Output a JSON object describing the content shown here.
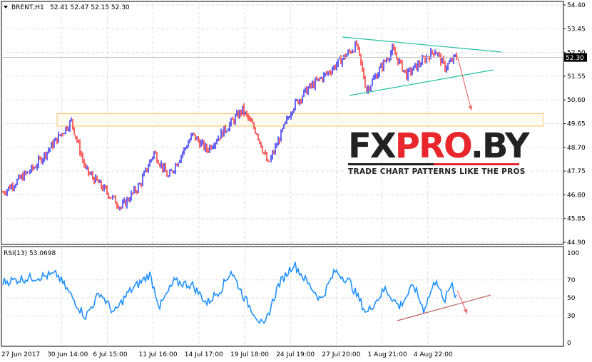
{
  "header": {
    "symbol": "BRENT,H1",
    "ohlc": "52.41 52.47 52.15 52.30"
  },
  "rsi_label": "RSI(13) 53.0698",
  "current_price": "52.30",
  "logo": {
    "part1": "FX",
    "part2": "PRO",
    "part3": ".BY",
    "tagline": "TRADE CHART PATTERNS LIKE THE PROS"
  },
  "colors": {
    "up": "#0000ff",
    "down": "#ff0000",
    "rsi": "#1e90ff",
    "triangle": "#20c0a0",
    "zone": "#f5c46a",
    "arrow": "#f07070",
    "rsi_trend": "#c06060"
  },
  "chart_data": [
    {
      "type": "candlestick",
      "title": "BRENT,H1",
      "price_ylim": [
        44.9,
        54.4
      ],
      "yticks": [
        "54.40",
        "53.45",
        "52.50",
        "51.55",
        "50.60",
        "49.65",
        "48.70",
        "47.75",
        "46.80",
        "45.85",
        "44.90"
      ],
      "xticks": [
        "27 Jun 2017",
        "30 Jun 14:00",
        "6 Jul 15:00",
        "11 Jul 16:00",
        "14 Jul 17:00",
        "19 Jul 18:00",
        "24 Jul 19:00",
        "27 Jul 20:00",
        "1 Aug 21:00",
        "4 Aug 22:00"
      ],
      "close_keypoints": [
        [
          0,
          46.9
        ],
        [
          22,
          47.9
        ],
        [
          48,
          49.75
        ],
        [
          58,
          47.8
        ],
        [
          73,
          46.9
        ],
        [
          83,
          46.3
        ],
        [
          96,
          47.2
        ],
        [
          106,
          48.5
        ],
        [
          116,
          47.5
        ],
        [
          133,
          49.2
        ],
        [
          143,
          48.6
        ],
        [
          168,
          50.2
        ],
        [
          178,
          49.3
        ],
        [
          186,
          48.0
        ],
        [
          203,
          50.3
        ],
        [
          213,
          51.0
        ],
        [
          228,
          51.7
        ],
        [
          248,
          52.8
        ],
        [
          255,
          51.0
        ],
        [
          273,
          52.6
        ],
        [
          283,
          51.6
        ],
        [
          303,
          52.6
        ],
        [
          310,
          51.9
        ],
        [
          317,
          52.3
        ]
      ],
      "support_zone": [
        49.55,
        50.05
      ]
    },
    {
      "type": "line",
      "title": "RSI(13)",
      "ylim": [
        0,
        100
      ],
      "yticks": [
        "100",
        "70",
        "50",
        "30",
        "0"
      ],
      "keypoints": [
        [
          0,
          68
        ],
        [
          18,
          72
        ],
        [
          38,
          76
        ],
        [
          53,
          40
        ],
        [
          58,
          29
        ],
        [
          68,
          56
        ],
        [
          78,
          33
        ],
        [
          88,
          56
        ],
        [
          103,
          76
        ],
        [
          110,
          40
        ],
        [
          120,
          68
        ],
        [
          133,
          64
        ],
        [
          143,
          44
        ],
        [
          153,
          60
        ],
        [
          160,
          80
        ],
        [
          170,
          48
        ],
        [
          183,
          17
        ],
        [
          193,
          64
        ],
        [
          204,
          88
        ],
        [
          213,
          68
        ],
        [
          223,
          48
        ],
        [
          233,
          80
        ],
        [
          243,
          68
        ],
        [
          255,
          33
        ],
        [
          268,
          60
        ],
        [
          278,
          40
        ],
        [
          288,
          64
        ],
        [
          295,
          37
        ],
        [
          304,
          72
        ],
        [
          309,
          44
        ],
        [
          315,
          68
        ],
        [
          317,
          53
        ]
      ]
    }
  ]
}
